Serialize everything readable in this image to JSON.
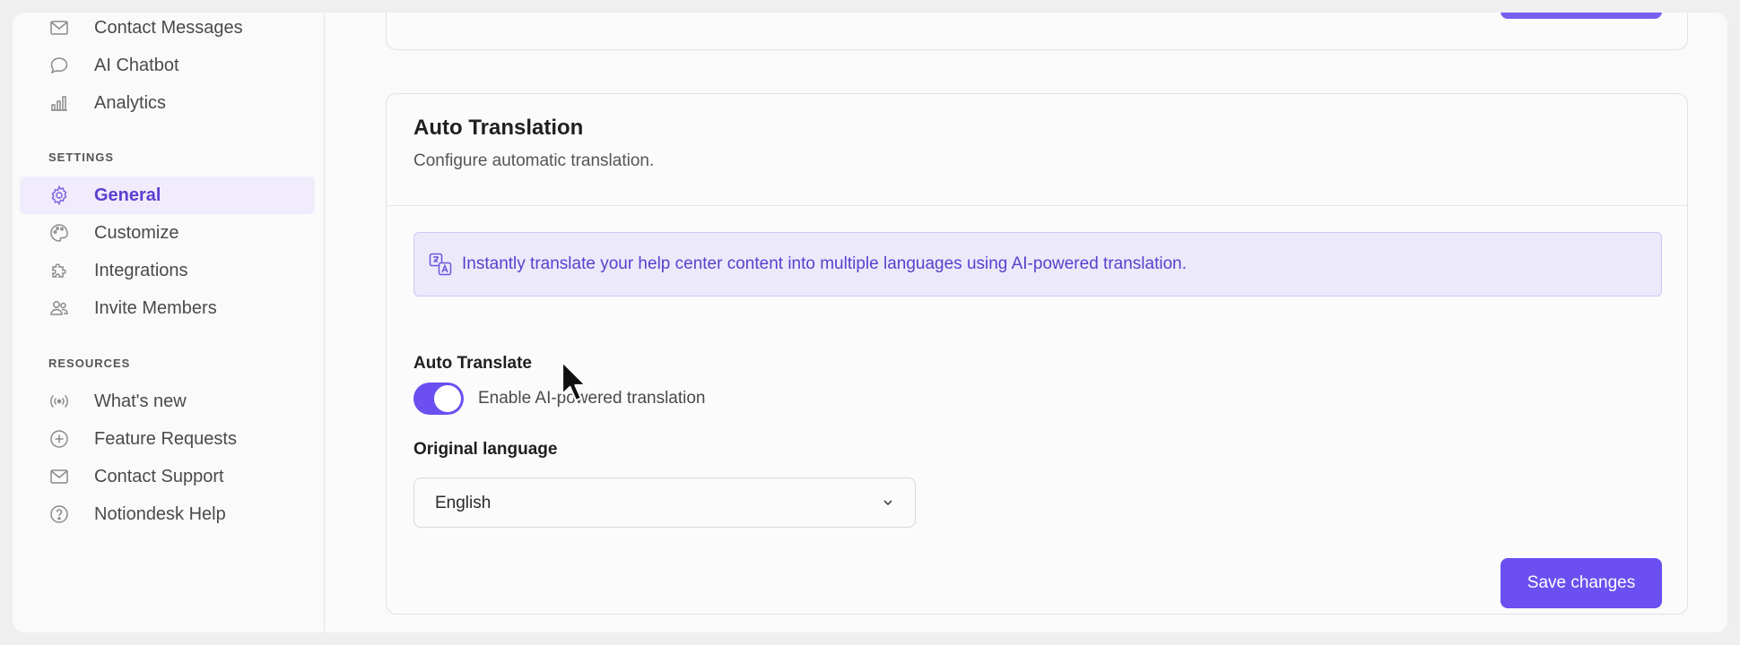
{
  "sidebar": {
    "top_items": [
      {
        "label": "Contact Messages",
        "icon": "envelope-icon"
      },
      {
        "label": "AI Chatbot",
        "icon": "chat-bubble-icon"
      },
      {
        "label": "Analytics",
        "icon": "bar-chart-icon"
      }
    ],
    "settings_header": "SETTINGS",
    "settings_items": [
      {
        "label": "General",
        "icon": "gear-icon",
        "active": true
      },
      {
        "label": "Customize",
        "icon": "palette-icon"
      },
      {
        "label": "Integrations",
        "icon": "puzzle-icon"
      },
      {
        "label": "Invite Members",
        "icon": "users-icon"
      }
    ],
    "resources_header": "RESOURCES",
    "resources_items": [
      {
        "label": "What's new",
        "icon": "broadcast-icon"
      },
      {
        "label": "Feature Requests",
        "icon": "plus-circle-icon"
      },
      {
        "label": "Contact Support",
        "icon": "envelope-icon"
      },
      {
        "label": "Notiondesk Help",
        "icon": "question-circle-icon"
      }
    ]
  },
  "auto_translation": {
    "title": "Auto Translation",
    "subtitle": "Configure automatic translation.",
    "info_icon": "translate-icon",
    "info_text": "Instantly translate your help center content into multiple languages using AI-powered translation.",
    "toggle_label": "Auto Translate",
    "toggle_text": "Enable AI-powered translation",
    "toggle_on": true,
    "language_label": "Original language",
    "language_value": "English",
    "save_label": "Save changes"
  },
  "colors": {
    "accent": "#6b4ff0",
    "active_nav_bg": "#f1ecfb",
    "info_bg": "#ece9fb"
  }
}
